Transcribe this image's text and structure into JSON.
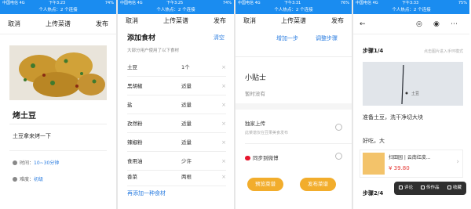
{
  "status": {
    "carrier": "中国电信 4G",
    "time_1": "下午3:23",
    "time_2": "下午3:25",
    "time_3": "下午3:31",
    "time_4": "下午3:33",
    "battery_1": "74%",
    "battery_2": "74%",
    "battery_3": "76%",
    "battery_4": "75%"
  },
  "hotspot": "个人热点：2 个连接",
  "nav": {
    "cancel": "取消",
    "title": "上传菜谱",
    "publish": "发布"
  },
  "screen1": {
    "recipe_title": "烤土豆",
    "description": "土豆拿来烤一下",
    "time_label": "时间：",
    "time_value": "10~30分钟",
    "difficulty_label": "难度：",
    "difficulty_value": "初级"
  },
  "screen2": {
    "heading": "添加食材",
    "clear": "清空",
    "subtitle": "大部分用户使用了以下食材",
    "ingredients": [
      {
        "name": "土豆",
        "amount": "1个"
      },
      {
        "name": "黑胡椒",
        "amount": "适量"
      },
      {
        "name": "盐",
        "amount": "适量"
      },
      {
        "name": "孜然粉",
        "amount": "适量"
      },
      {
        "name": "辣椒粉",
        "amount": "适量"
      },
      {
        "name": "食用油",
        "amount": "少许"
      },
      {
        "name": "香菜",
        "amount": "两根"
      }
    ],
    "add_more": "再添加一种食材",
    "remove_glyph": "×"
  },
  "screen3": {
    "add_step": "增加一步",
    "adjust_steps": "调整步骤",
    "tips_title": "小贴士",
    "tips_empty": "暂时没有",
    "exclusive": "独家上传",
    "exclusive_sub": "此菜谱仅在豆果美食发布",
    "weibo": "同步到微博",
    "preview": "预览菜谱",
    "publish": "发布菜谱"
  },
  "screen4": {
    "step1": "步骤1/4",
    "hint": "点击图片进入手环模式",
    "photo_caption": "土豆",
    "step_desc": "准备土豆，洗干净切大块",
    "goods_label": "好吃，大",
    "product_name": "扫田园 | 云南红皮...",
    "product_price": "¥ 39.80",
    "step2": "步骤2/4",
    "actions": {
      "comment": "评论",
      "work": "传作品",
      "collect": "收藏"
    }
  }
}
